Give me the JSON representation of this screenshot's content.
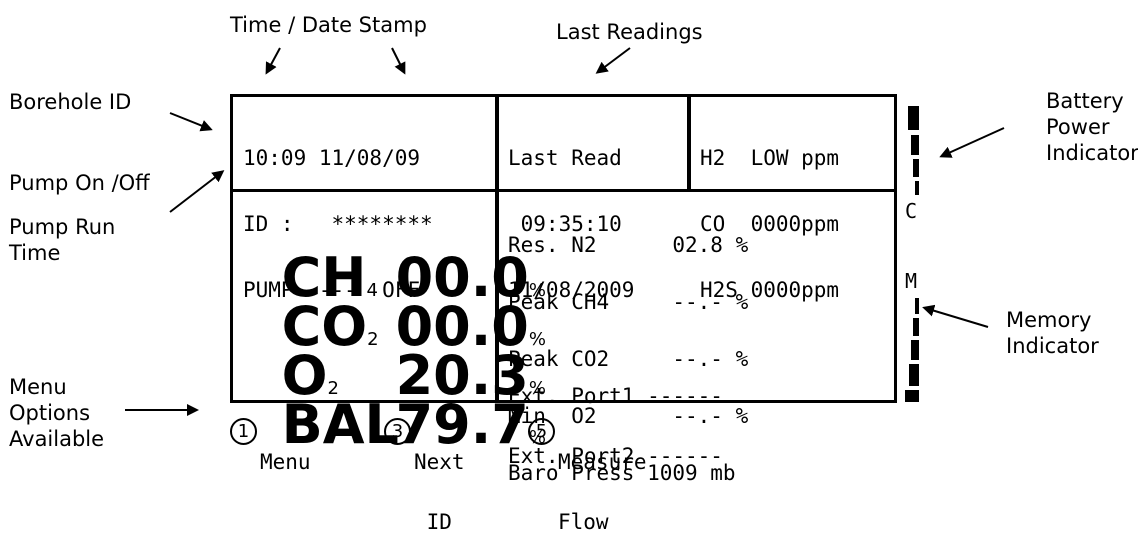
{
  "annotations": {
    "time_date_stamp": "Time / Date Stamp",
    "last_readings": "Last Readings",
    "borehole_id": "Borehole ID",
    "pump_onoff": "Pump On /Off",
    "pump_run_time": [
      "Pump Run",
      "Time"
    ],
    "menu_options": [
      "Menu",
      "Options",
      "Available"
    ],
    "battery": [
      "Battery",
      "Power",
      "Indicator"
    ],
    "memory": [
      "Memory",
      "Indicator"
    ]
  },
  "screen": {
    "header_left": [
      "10:09 11/08/09",
      "ID :   ********",
      "PUMP  ---  OFF"
    ],
    "last_read": [
      "Last Read",
      " 09:35:10",
      "11/08/2009"
    ],
    "gas_low": [
      "H2  LOW ppm",
      "CO  0000ppm",
      "H2S 0000ppm"
    ],
    "gases": [
      {
        "name": "CH",
        "sub": "4",
        "value": "00.0",
        "unit": "%"
      },
      {
        "name": "CO",
        "sub": "2",
        "value": "00.0",
        "unit": "%"
      },
      {
        "name": "O",
        "sub": "2",
        "value": "20.3",
        "unit": "%"
      },
      {
        "name": "BAL",
        "sub": "",
        "value": "79.7",
        "unit": "%"
      }
    ],
    "readings": [
      "Res. N2      02.8 %",
      "Peak CH4     --.- %",
      "Peak CO2     --.- %",
      "Min  O2      --.- %",
      "Baro Press 1009 mb"
    ],
    "ports": [
      "Ext. Port1 ------",
      "Ext. Port2 ------"
    ],
    "battery_letter": "C",
    "memory_letter": "M",
    "menu": [
      {
        "num": "1",
        "line1": "Menu",
        "line2": ""
      },
      {
        "num": "3",
        "line1": "Next",
        "line2": " ID"
      },
      {
        "num": "5",
        "line1": "Measure",
        "line2": "Flow"
      }
    ]
  }
}
